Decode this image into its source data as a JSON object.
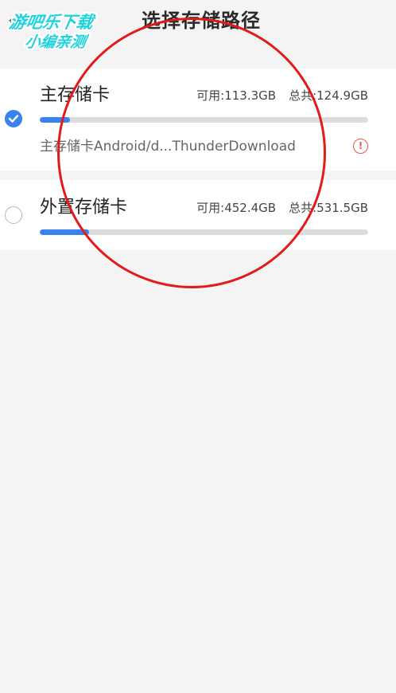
{
  "header": {
    "back_glyph": "‹",
    "title": "选择存储路径"
  },
  "watermark": {
    "line1": "游吧乐下载",
    "line2": "小编亲测"
  },
  "storages": [
    {
      "name": "主存储卡",
      "available": "可用:113.3GB",
      "total": "总共:124.9GB",
      "used_fraction": 0.093,
      "selected": true,
      "path": "主存储卡Android/d...ThunderDownload",
      "warning_glyph": "!"
    },
    {
      "name": "外置存储卡",
      "available": "可用:452.4GB",
      "total": "总共:531.5GB",
      "used_fraction": 0.149,
      "selected": false
    }
  ],
  "colors": {
    "accent": "#3b82f0",
    "warning": "#e5574a",
    "annotation": "#e21a1a",
    "background": "#f4f4f4"
  },
  "icons": {
    "back": "chevron-left-icon",
    "checked": "check-circle-icon",
    "unchecked": "radio-empty-icon",
    "warning": "exclamation-circle-icon"
  }
}
